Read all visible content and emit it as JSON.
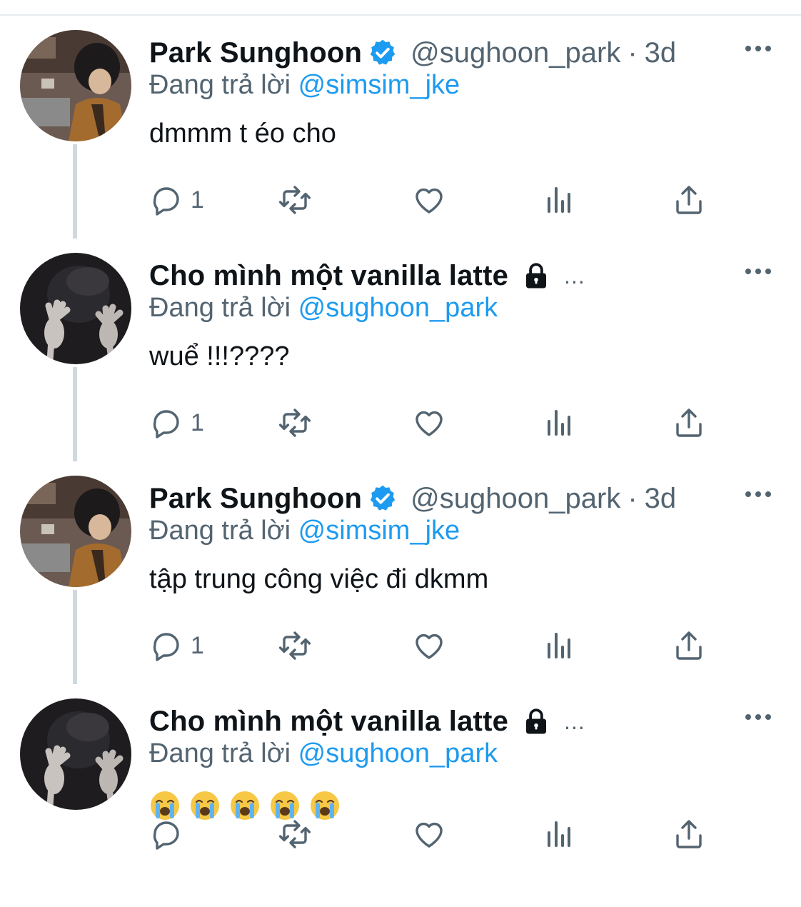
{
  "thread": [
    {
      "display_name": "Park Sunghoon",
      "verified": true,
      "handle": "@sughoon_park",
      "separator": "·",
      "time": "3d",
      "locked": false,
      "reply_prefix": "Đang trả lời",
      "reply_to": "@simsim_jke",
      "text": "dmmm t éo cho",
      "reply_count": "1",
      "avatar": "avatar-man-brown-jacket"
    },
    {
      "display_name": "Cho mình một vanilla latte",
      "verified": false,
      "locked": true,
      "truncation": "...",
      "reply_prefix": "Đang trả lời",
      "reply_to": "@sughoon_park",
      "text": "wuể !!!????",
      "reply_count": "1",
      "avatar": "avatar-hands-dark"
    },
    {
      "display_name": "Park Sunghoon",
      "verified": true,
      "handle": "@sughoon_park",
      "separator": "·",
      "time": "3d",
      "locked": false,
      "reply_prefix": "Đang trả lời",
      "reply_to": "@simsim_jke",
      "text": "tập trung công việc đi dkmm",
      "reply_count": "1",
      "avatar": "avatar-man-brown-jacket"
    },
    {
      "display_name": "Cho mình một vanilla latte",
      "verified": false,
      "locked": true,
      "truncation": "...",
      "reply_prefix": "Đang trả lời",
      "reply_to": "@sughoon_park",
      "emojis": [
        "loudly-crying-face",
        "loudly-crying-face",
        "loudly-crying-face",
        "loudly-crying-face",
        "loudly-crying-face"
      ],
      "reply_count": "",
      "avatar": "avatar-hands-dark"
    }
  ],
  "icons": [
    "more-icon",
    "verified-badge-icon",
    "lock-icon",
    "reply-icon",
    "retweet-icon",
    "like-icon",
    "analytics-icon",
    "share-icon"
  ],
  "colors": {
    "accent": "#1d9bf0",
    "secondary_text": "#536471",
    "primary_text": "#0f1419",
    "thread_line": "#cfd9de"
  }
}
